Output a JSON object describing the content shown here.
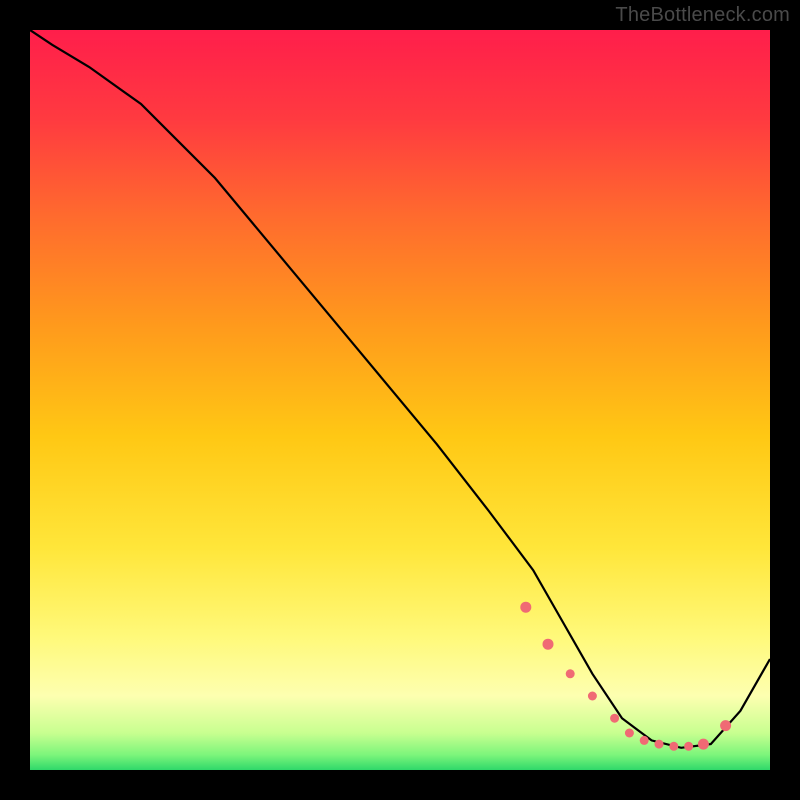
{
  "watermark": "TheBottleneck.com",
  "chart_data": {
    "type": "line",
    "title": "",
    "xlabel": "",
    "ylabel": "",
    "xlim": [
      0,
      100
    ],
    "ylim": [
      0,
      100
    ],
    "series": [
      {
        "name": "curve",
        "x": [
          0,
          3,
          8,
          15,
          25,
          35,
          45,
          55,
          62,
          68,
          72,
          76,
          80,
          84,
          88,
          92,
          96,
          100
        ],
        "y": [
          100,
          98,
          95,
          90,
          80,
          68,
          56,
          44,
          35,
          27,
          20,
          13,
          7,
          4,
          3,
          3.5,
          8,
          15
        ]
      }
    ],
    "low_markers": {
      "x": [
        67,
        70,
        73,
        76,
        79,
        81,
        83,
        85,
        87,
        89,
        91,
        94
      ],
      "y": [
        22,
        17,
        13,
        10,
        7,
        5,
        4,
        3.5,
        3.2,
        3.2,
        3.5,
        6
      ]
    },
    "gradient_stops": [
      {
        "offset": 0.0,
        "color": "#ff1e4b"
      },
      {
        "offset": 0.12,
        "color": "#ff3a40"
      },
      {
        "offset": 0.25,
        "color": "#ff6a2e"
      },
      {
        "offset": 0.4,
        "color": "#ff9a1c"
      },
      {
        "offset": 0.55,
        "color": "#ffc814"
      },
      {
        "offset": 0.7,
        "color": "#ffe63a"
      },
      {
        "offset": 0.82,
        "color": "#fff97a"
      },
      {
        "offset": 0.9,
        "color": "#fdffb0"
      },
      {
        "offset": 0.95,
        "color": "#c8ff90"
      },
      {
        "offset": 0.98,
        "color": "#7bf57b"
      },
      {
        "offset": 1.0,
        "color": "#2fd86a"
      }
    ]
  }
}
